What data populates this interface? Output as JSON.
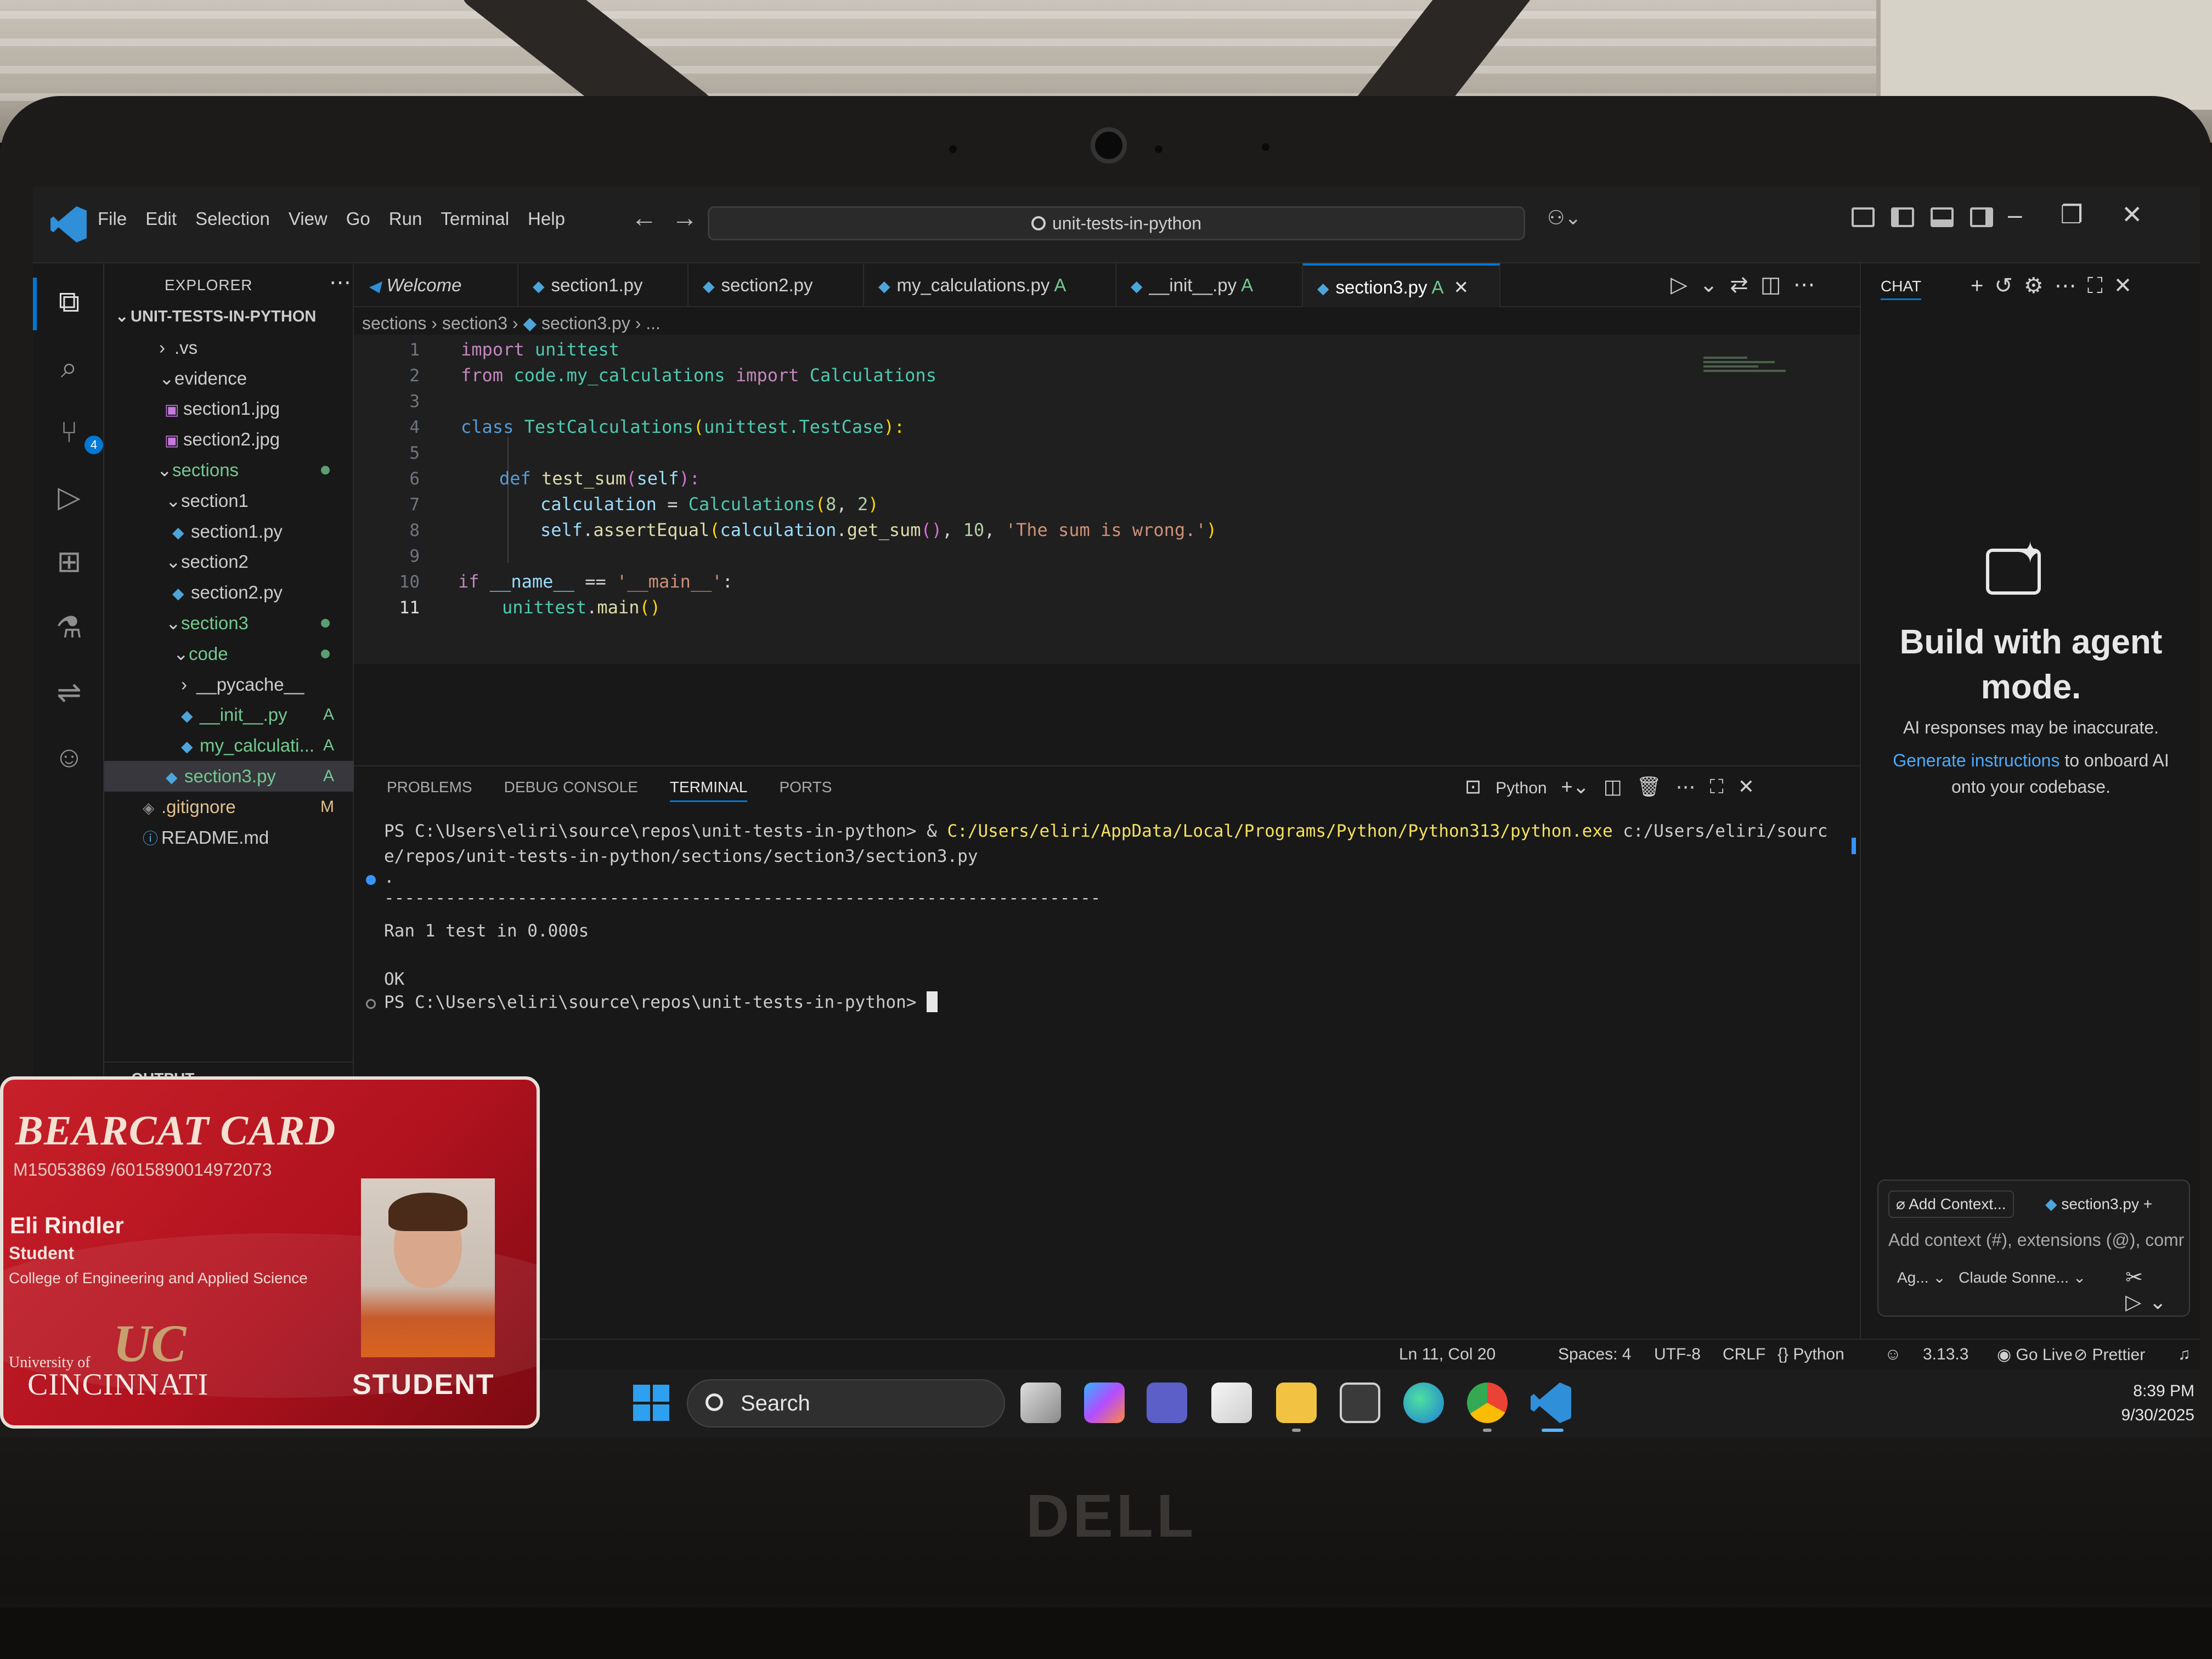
{
  "titlebar": {
    "menu": [
      "File",
      "Edit",
      "Selection",
      "View",
      "Go",
      "Run",
      "Terminal",
      "Help"
    ],
    "search_text": "unit-tests-in-python"
  },
  "activity": {
    "scm_badge": "4"
  },
  "explorer": {
    "header": "EXPLORER",
    "root": "UNIT-TESTS-IN-PYTHON",
    "items": [
      {
        "label": ".vs",
        "chev": "›"
      },
      {
        "label": "evidence",
        "chev": "⌄"
      },
      {
        "label": "section1.jpg"
      },
      {
        "label": "section2.jpg"
      },
      {
        "label": "sections",
        "chev": "⌄"
      },
      {
        "label": "section1",
        "chev": "⌄"
      },
      {
        "label": "section1.py"
      },
      {
        "label": "section2",
        "chev": "⌄"
      },
      {
        "label": "section2.py"
      },
      {
        "label": "section3",
        "chev": "⌄"
      },
      {
        "label": "code",
        "chev": "⌄"
      },
      {
        "label": "__pycache__",
        "chev": "›"
      },
      {
        "label": "__init__.py",
        "status": "A"
      },
      {
        "label": "my_calculati...",
        "status": "A"
      },
      {
        "label": "section3.py",
        "status": "A"
      },
      {
        "label": ".gitignore",
        "status": "M"
      },
      {
        "label": "README.md"
      }
    ],
    "output_label": "OUTPUT"
  },
  "tabs": [
    {
      "label": "Welcome"
    },
    {
      "label": "section1.py"
    },
    {
      "label": "section2.py"
    },
    {
      "label": "my_calculations.py",
      "status": "A"
    },
    {
      "label": "__init__.py",
      "status": "A"
    },
    {
      "label": "section3.py",
      "status": "A",
      "close": "✕"
    }
  ],
  "breadcrumb": {
    "a": "sections",
    "b": "section3",
    "c": "section3.py",
    "d": "..."
  },
  "code_lines": [
    "1",
    "2",
    "3",
    "4",
    "5",
    "6",
    "7",
    "8",
    "9",
    "10",
    "11"
  ],
  "code": {
    "l1a": "import",
    "l1b": " unittest",
    "l2a": "from",
    "l2b": " code.my_calculations ",
    "l2c": "import",
    "l2d": " Calculations",
    "l4a": "class",
    "l4b": " TestCalculations",
    "l4c": "(",
    "l4d": "unittest.TestCase",
    "l4e": "):",
    "l6a": "def",
    "l6b": " test_sum",
    "l6c": "(",
    "l6d": "self",
    "l6e": "):",
    "l7a": "calculation",
    "l7b": " = ",
    "l7c": "Calculations",
    "l7d": "(",
    "l7e": "8",
    "l7f": ", ",
    "l7g": "2",
    "l7h": ")",
    "l8a": "self",
    "l8b": ".",
    "l8c": "assertEqual",
    "l8d": "(",
    "l8e": "calculation",
    "l8f": ".",
    "l8g": "get_sum",
    "l8h": "()",
    "l8i": ", ",
    "l8j": "10",
    "l8k": ", ",
    "l8l": "'The sum is wrong.'",
    "l8m": ")",
    "l10a": "if",
    "l10b": " __name__ ",
    "l10c": "==",
    "l10d": " '__main__'",
    "l10e": ":",
    "l11a": "unittest",
    "l11b": ".",
    "l11c": "main",
    "l11d": "()"
  },
  "panel": {
    "tabs": [
      "PROBLEMS",
      "DEBUG CONSOLE",
      "TERMINAL",
      "PORTS"
    ],
    "shell": "Python"
  },
  "terminal": {
    "line1a": "PS C:\\Users\\eliri\\source\\repos\\unit-tests-in-python> & ",
    "line1b": "C:/Users/eliri/AppData/Local/Programs/Python/Python313/python.exe",
    "line1c": " c:/Users/eliri/sourc",
    "line2": "e/repos/unit-tests-in-python/sections/section3/section3.py",
    "line3": ".",
    "line4": "----------------------------------------------------------------------",
    "line5": "Ran 1 test in 0.000s",
    "line6": "OK",
    "line7": "PS C:\\Users\\eliri\\source\\repos\\unit-tests-in-python> "
  },
  "chat": {
    "title": "CHAT",
    "heading": "Build with agent mode.",
    "note": "AI responses may be inaccurate.",
    "link": "Generate instructions",
    "link_rest": " to onboard AI onto your codebase.",
    "add_context": "Add Context...",
    "file_chip": "section3.py",
    "placeholder": "Add context (#), extensions (@), comr",
    "mode": "Ag...",
    "model": "Claude Sonne..."
  },
  "status": {
    "position": "Ln 11, Col 20",
    "spaces": "Spaces: 4",
    "encoding": "UTF-8",
    "eol": "CRLF",
    "language": "Python",
    "version": "3.13.3",
    "golive": "Go Live",
    "prettier": "Prettier"
  },
  "taskbar": {
    "search": "Search",
    "time": "8:39 PM",
    "date": "9/30/2025"
  },
  "card": {
    "title": "BEARCAT CARD",
    "id": "M15053869 /6015890014972073",
    "name": "Eli Rindler",
    "role": "Student",
    "college": "College of Engineering and Applied Science",
    "univ": "University of",
    "cincy": "CINCINNATI",
    "badge": "STUDENT",
    "logo_letters": "UC"
  },
  "laptop_brand": "DELL",
  "colors": {
    "accent": "#0078d4",
    "added": "#73c991",
    "modified": "#e2c08d",
    "card_red": "#c8202a"
  }
}
